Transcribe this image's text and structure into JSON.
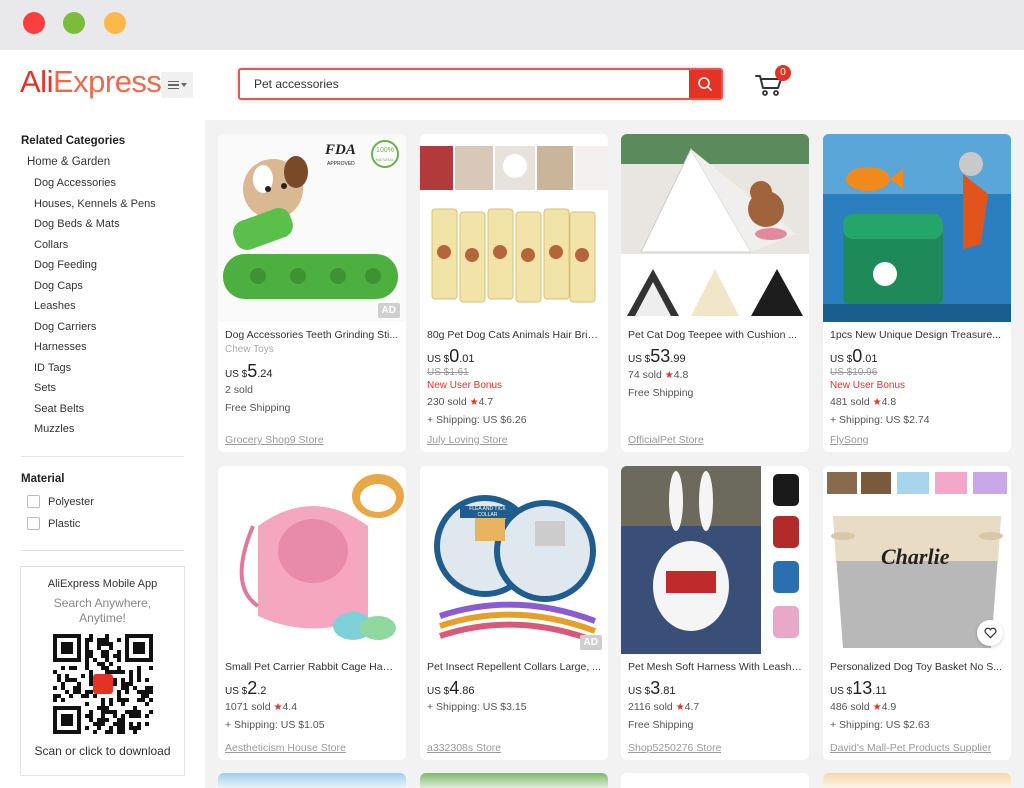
{
  "window": {
    "controls": [
      "close",
      "minimize",
      "maximize"
    ]
  },
  "header": {
    "logo_part1": "Ali",
    "logo_part2": "Express",
    "menu_icon": "menu-icon",
    "search_value": "Pet accessories",
    "search_icon": "search-icon",
    "cart_icon": "cart-icon",
    "cart_count": "0",
    "accent": "#e43225"
  },
  "sidebar": {
    "related_heading": "Related Categories",
    "top_category": "Home & Garden",
    "categories": [
      "Dog Accessories",
      "Houses, Kennels & Pens",
      "Dog Beds & Mats",
      "Collars",
      "Dog Feeding",
      "Dog Caps",
      "Leashes",
      "Dog Carriers",
      "Harnesses",
      "ID Tags",
      "Sets",
      "Seat Belts",
      "Muzzles"
    ],
    "material_heading": "Material",
    "materials": [
      "Polyester",
      "Plastic"
    ],
    "app": {
      "title": "AliExpress Mobile App",
      "subtitle": "Search Anywhere, Anytime!",
      "download": "Scan or click to download"
    }
  },
  "products": [
    {
      "title": "Dog Accessories Teeth Grinding Sti...",
      "subtitle": "Chew Toys",
      "currency": "US $",
      "price_int": "5",
      "price_cents": ".24",
      "lines": [
        "2 sold",
        "Free Shipping"
      ],
      "store": "Grocery Shop9 Store",
      "ad": "AD",
      "badges": [
        "FDA",
        "APPROVED",
        "100%",
        "NATURAL"
      ]
    },
    {
      "title": "80g Pet Dog Cats Animals Hair Brig...",
      "currency": "US $",
      "price_int": "0",
      "price_cents": ".01",
      "original": "US $1.61",
      "bonus": "New User Bonus",
      "sold": "230 sold",
      "rating": "4.7",
      "shipping": "+ Shipping: US $6.26",
      "store": "July Loving Store"
    },
    {
      "title": "Pet Cat Dog Teepee with Cushion ...",
      "currency": "US $",
      "price_int": "53",
      "price_cents": ".99",
      "sold": "74 sold",
      "rating": "4.8",
      "shipping": "Free Shipping",
      "store": "OfficialPet Store"
    },
    {
      "title": "1pcs New Unique Design Treasure...",
      "currency": "US $",
      "price_int": "0",
      "price_cents": ".01",
      "original": "US $10.96",
      "bonus": "New User Bonus",
      "sold": "481 sold",
      "rating": "4.8",
      "shipping": "+ Shipping: US $2.74",
      "store": "FlySong"
    },
    {
      "title": "Small Pet Carrier Rabbit Cage Ham...",
      "currency": "US $",
      "price_int": "2",
      "price_cents": ".2",
      "sold": "1071 sold",
      "rating": "4.4",
      "shipping": "+ Shipping: US $1.05",
      "store": "Aestheticism House Store"
    },
    {
      "title": "Pet Insect Repellent Collars Large, ...",
      "currency": "US $",
      "price_int": "4",
      "price_cents": ".86",
      "shipping": "+ Shipping: US $3.15",
      "store": "a332308s Store",
      "ad": "AD",
      "collar_text": "FLEA AND TICK COLLAR"
    },
    {
      "title": "Pet Mesh Soft Harness With Leash ...",
      "currency": "US $",
      "price_int": "3",
      "price_cents": ".81",
      "sold": "2116 sold",
      "rating": "4.7",
      "shipping": "Free Shipping",
      "store": "Shop5250276 Store"
    },
    {
      "title": "Personalized Dog Toy Basket No S...",
      "currency": "US $",
      "price_int": "13",
      "price_cents": ".11",
      "sold": "486 sold",
      "rating": "4.9",
      "shipping": "+ Shipping: US $2.63",
      "store": "David's Mall-Pet Products Supplier",
      "basket_name": "Charlie"
    }
  ]
}
